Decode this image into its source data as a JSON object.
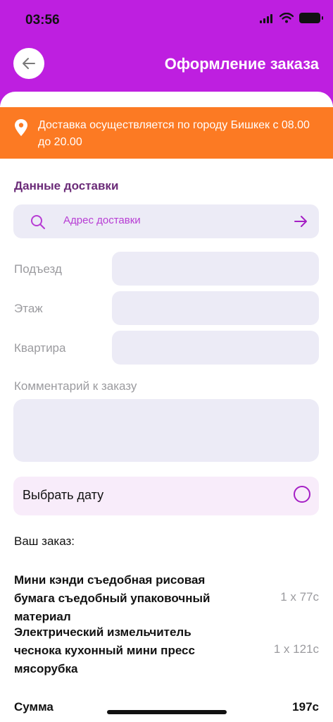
{
  "status_bar": {
    "time": "03:56"
  },
  "header": {
    "title": "Оформление заказа"
  },
  "banner": {
    "text": "Доставка осуществляется по городу Бишкек с 08.00 до 20.00"
  },
  "delivery": {
    "section_title": "Данные доставки",
    "address_placeholder": "Адрес доставки",
    "fields": [
      {
        "label": "Подъезд",
        "value": ""
      },
      {
        "label": "Этаж",
        "value": ""
      },
      {
        "label": "Квартира",
        "value": ""
      }
    ],
    "comment_label": "Комментарий к заказу",
    "comment_value": ""
  },
  "date_picker": {
    "label": "Выбрать дату",
    "selected": false
  },
  "order": {
    "title": "Ваш заказ:",
    "items": [
      {
        "name": "Мини кэнди съедобная рисовая бумага съедобный упаковочный материал",
        "qty": "1 x 77с"
      },
      {
        "name": "Электрический измельчитель чеснока кухонный мини пресс мясорубка",
        "qty": "1 x 121с"
      }
    ],
    "sum_label": "Сумма",
    "sum_value": "197с"
  },
  "colors": {
    "header": "#be1fe0",
    "banner": "#fc7a23",
    "accent": "#b73cd4",
    "input_bg": "#ecebf6"
  }
}
